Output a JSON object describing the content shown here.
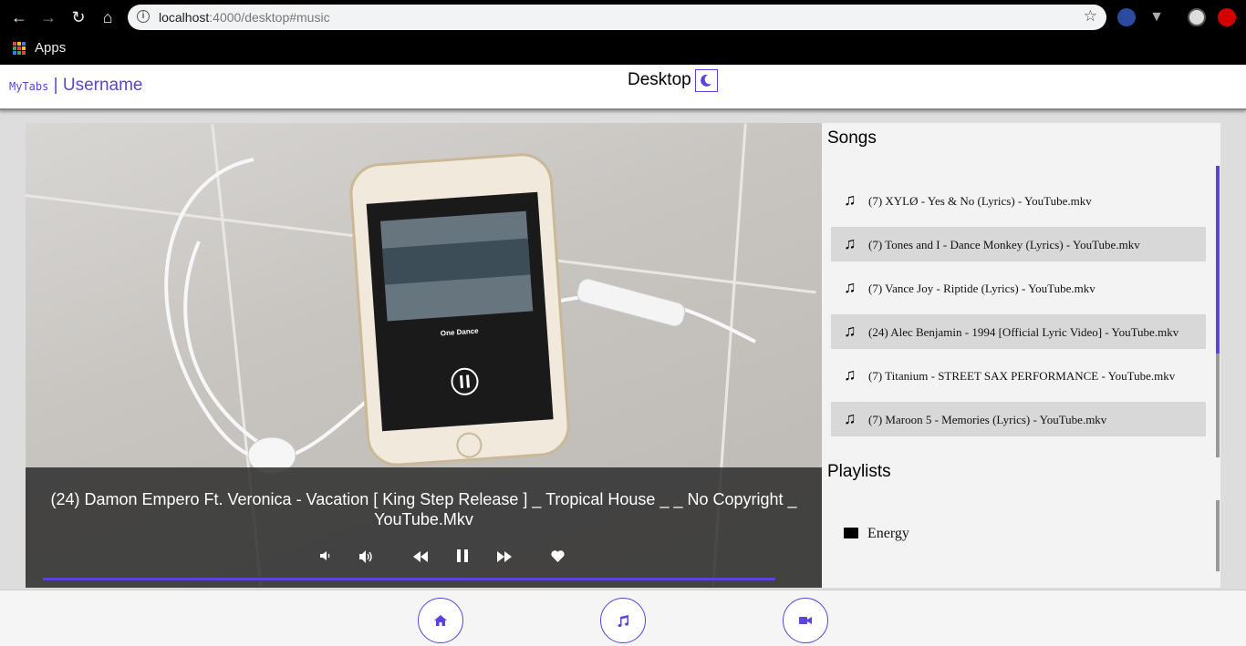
{
  "browser": {
    "url_host": "localhost",
    "url_rest": ":4000/desktop#music",
    "bookmarks_label": "Apps"
  },
  "header": {
    "brand": "MyTabs",
    "separator": " | ",
    "username": "Username",
    "title": "Desktop"
  },
  "player": {
    "now_playing": "(24) Damon Empero Ft. Veronica - Vacation [ King Step Release ] _ Tropical House _ _ No Copyright _ YouTube.Mkv",
    "progress": 0.92
  },
  "songs": {
    "heading": "Songs",
    "items": [
      {
        "label": "(7) XYLØ - Yes & No (Lyrics) - YouTube.mkv"
      },
      {
        "label": "(7) Tones and I - Dance Monkey (Lyrics) - YouTube.mkv"
      },
      {
        "label": "(7) Vance Joy - Riptide (Lyrics) - YouTube.mkv"
      },
      {
        "label": "(24) Alec Benjamin - 1994 [Official Lyric Video] - YouTube.mkv"
      },
      {
        "label": "(7) Titanium - STREET SAX PERFORMANCE - YouTube.mkv"
      },
      {
        "label": "(7) Maroon 5 - Memories (Lyrics) - YouTube.mkv"
      }
    ]
  },
  "playlists": {
    "heading": "Playlists",
    "items": [
      {
        "label": "Energy"
      }
    ]
  },
  "colors": {
    "accent": "#5b45d6"
  }
}
